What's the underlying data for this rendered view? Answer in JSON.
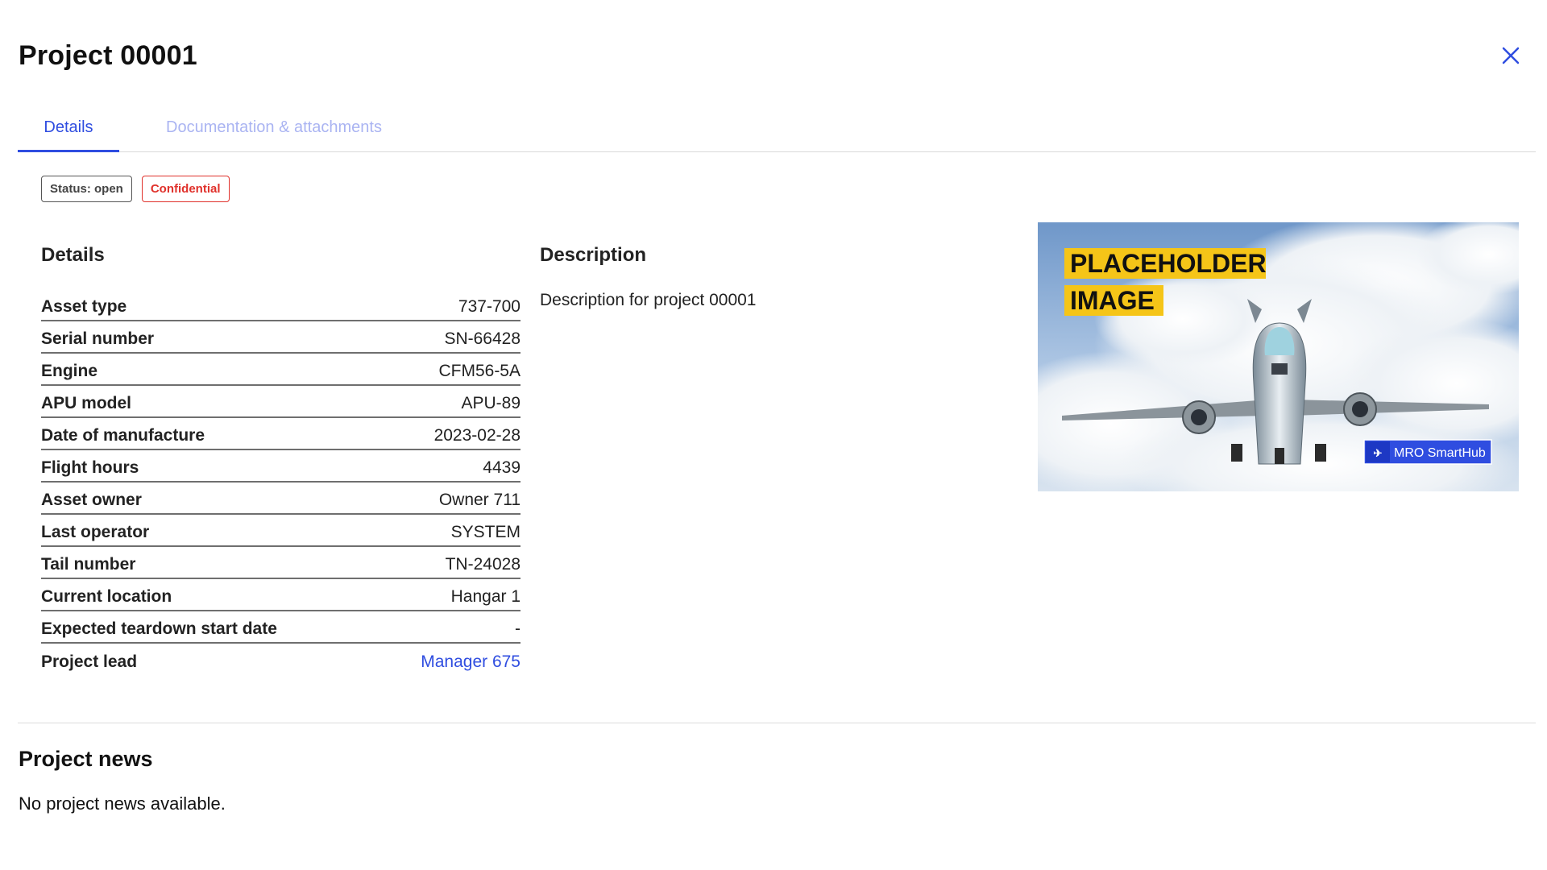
{
  "header": {
    "title": "Project 00001",
    "close_icon": "close-icon"
  },
  "tabs": [
    {
      "label": "Details",
      "active": true
    },
    {
      "label": "Documentation & attachments",
      "active": false
    }
  ],
  "badges": {
    "status": "Status: open",
    "confidential": "Confidential"
  },
  "details": {
    "heading": "Details",
    "rows": [
      {
        "label": "Asset type",
        "value": "737-700"
      },
      {
        "label": "Serial number",
        "value": "SN-66428"
      },
      {
        "label": "Engine",
        "value": "CFM56-5A"
      },
      {
        "label": "APU model",
        "value": "APU-89"
      },
      {
        "label": "Date of manufacture",
        "value": "2023-02-28"
      },
      {
        "label": "Flight hours",
        "value": "4439"
      },
      {
        "label": "Asset owner",
        "value": "Owner 711"
      },
      {
        "label": "Last operator",
        "value": "SYSTEM"
      },
      {
        "label": "Tail number",
        "value": "TN-24028"
      },
      {
        "label": "Current location",
        "value": "Hangar 1"
      },
      {
        "label": "Expected teardown start date",
        "value": "-"
      },
      {
        "label": "Project lead",
        "value": "Manager 675"
      }
    ]
  },
  "description": {
    "heading": "Description",
    "text": "Description for project 00001"
  },
  "image": {
    "line1": "PLACEHOLDER",
    "line2": "IMAGE",
    "brand": "MRO SmartHub",
    "brand_logo": "iata-logo"
  },
  "news": {
    "heading": "Project news",
    "empty_text": "No project news available."
  },
  "colors": {
    "accent": "#2f4de0",
    "tab_inactive": "#aab4f2",
    "confidential": "#e0312b",
    "label_highlight": "#f5c518"
  }
}
